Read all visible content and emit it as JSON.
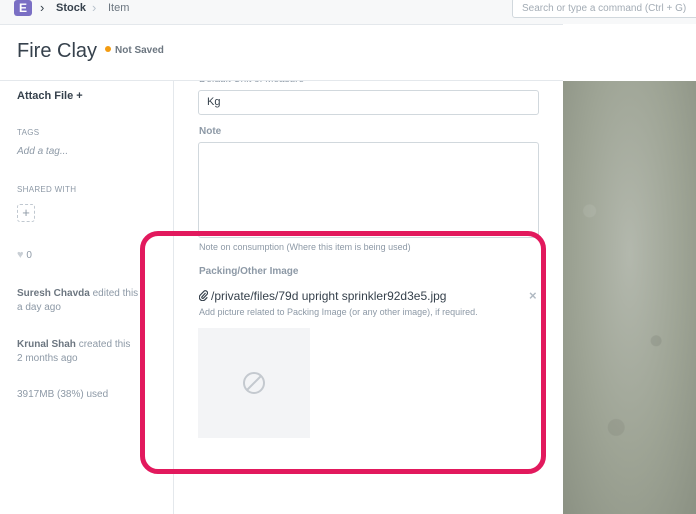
{
  "navbar": {
    "logo_letter": "E",
    "breadcrumbs": [
      "Stock",
      "Item"
    ],
    "search_placeholder": "Search or type a command (Ctrl + G)"
  },
  "header": {
    "title": "Fire Clay",
    "status": "Not Saved",
    "status_color": "#f39c12"
  },
  "sidebar": {
    "attach_label": "Attach File",
    "tags_heading": "TAGS",
    "add_tag": "Add a tag...",
    "shared_heading": "SHARED WITH",
    "likes": "0",
    "activity": [
      {
        "name": "Suresh Chavda",
        "action": "edited this",
        "time": "a day ago"
      },
      {
        "name": "Krunal Shah",
        "action": "created this",
        "time": "2 months ago"
      }
    ],
    "usage": "3917MB (38%) used"
  },
  "form": {
    "uom_label": "Default Unit of Measure",
    "uom_value": "Kg",
    "note_label": "Note",
    "note_help": "Note on consumption (Where this item is being used)",
    "image_label": "Packing/Other Image",
    "image_file": "/private/files/79d upright sprinkler92d3e5.jpg",
    "image_help": "Add picture related to Packing Image (or any other image), if required."
  },
  "colors": {
    "highlight": "#e2195d",
    "logo_bg": "#7a6fc4"
  }
}
